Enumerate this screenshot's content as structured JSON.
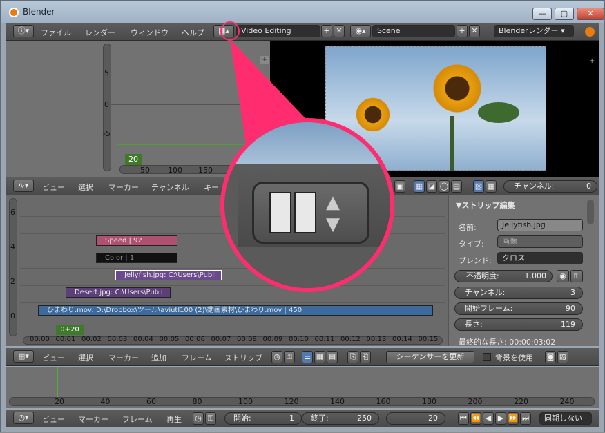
{
  "window": {
    "title": "Blender",
    "min": "—",
    "max": "▢",
    "close": "✕"
  },
  "info_header": {
    "menus": [
      "ファイル",
      "レンダー",
      "ウィンドウ",
      "ヘルプ"
    ],
    "screen_layout": "Video Editing",
    "scene": "Scene",
    "render_engine": "Blenderレンダー"
  },
  "graph_area": {
    "y_ticks": [
      "5",
      "0",
      "-5"
    ],
    "x_ticks": [
      "50",
      "100",
      "150"
    ],
    "current_frame": "20"
  },
  "mid_header": {
    "menus": [
      "ビュー",
      "選択",
      "マーカー",
      "チャンネル",
      "キー"
    ],
    "channel_label": "チャンネル:",
    "channel_value": "0"
  },
  "sequencer": {
    "y_ticks": [
      "6",
      "4",
      "2",
      "0"
    ],
    "strips": [
      {
        "text": "Speed | 92",
        "bg": "#b0506f"
      },
      {
        "text": "Color | 1",
        "bg": "#111111"
      },
      {
        "text": "Jellyfish.jpg: C:\\Users\\Publi",
        "bg": "#6a4a8c"
      },
      {
        "text": "Desert.jpg: C:\\Users\\Publi",
        "bg": "#5c3f79"
      },
      {
        "text": "ひまわり.mov: D:\\Dropbox\\ツール\\aviutl100 (2)\\動画素材\\ひまわり.mov | 450",
        "bg": "#3c6a9c"
      }
    ],
    "frame_badge": "0+20",
    "time_ticks": [
      "00:00",
      "00:01",
      "00:02",
      "00:03",
      "00:04",
      "00:05",
      "00:06",
      "00:07",
      "00:08",
      "00:09",
      "00:10",
      "00:11",
      "00:12",
      "00:13",
      "00:14",
      "00:15"
    ]
  },
  "strip_panel": {
    "title": "▼ストリップ編集",
    "name_label": "名前:",
    "name_value": "Jellyfish.jpg",
    "type_label": "タイプ:",
    "type_value": "画像",
    "blend_label": "ブレンド:",
    "blend_value": "クロス",
    "opacity_label": "不透明度:",
    "opacity_value": "1.000",
    "channel_label": "チャンネル:",
    "channel_value": "3",
    "start_label": "開始フレーム:",
    "start_value": "90",
    "length_label": "長さ:",
    "length_value": "119",
    "final_length": "最終的な長さ: 00:00:03:02"
  },
  "seq_header": {
    "menus": [
      "ビュー",
      "選択",
      "マーカー",
      "追加",
      "フレーム",
      "ストリップ"
    ],
    "refresh": "シーケンサーを更新",
    "use_bg": "背景を使用"
  },
  "timeline": {
    "ticks": [
      "20",
      "40",
      "60",
      "80",
      "100",
      "120",
      "140",
      "160",
      "180",
      "200",
      "220",
      "240"
    ]
  },
  "timeline_header": {
    "menus": [
      "ビュー",
      "マーカー",
      "フレーム",
      "再生"
    ],
    "start_label": "開始:",
    "start_value": "1",
    "end_label": "終了:",
    "end_value": "250",
    "current": "20",
    "sync": "同期しない"
  },
  "colors": {
    "accent": "#ff2d6f",
    "playhead": "#55b030"
  }
}
